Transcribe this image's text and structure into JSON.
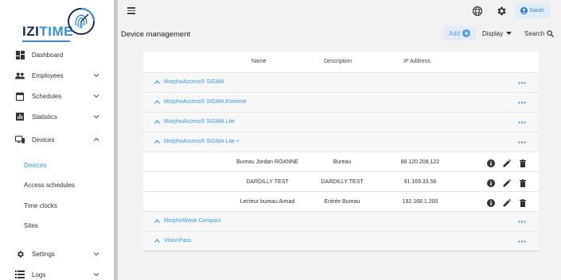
{
  "app": {
    "logo_part1": "IZI",
    "logo_part2": "TIME"
  },
  "sidebar": {
    "items": [
      {
        "label": "Dashboard"
      },
      {
        "label": "Employees"
      },
      {
        "label": "Schedules"
      },
      {
        "label": "Statistics"
      },
      {
        "label": "Devices"
      },
      {
        "label": "Settings"
      },
      {
        "label": "Logs"
      }
    ],
    "sub_items": [
      {
        "label": "Devices",
        "active": true
      },
      {
        "label": "Access schedules"
      },
      {
        "label": "Time clocks"
      },
      {
        "label": "Sites"
      }
    ]
  },
  "topbar": {
    "user_name": "Sarah"
  },
  "page": {
    "title": "Device management",
    "add_label": "Add",
    "display_label": "Display",
    "search_label": "Search"
  },
  "table": {
    "columns": [
      "Name",
      "Description",
      "IP Address"
    ],
    "groups": [
      {
        "label": "MorphoAccess® SIGMA"
      },
      {
        "label": "MorphoAccess® SIGMA Extreme"
      },
      {
        "label": "MorphoAccess® SIGMA Lite"
      },
      {
        "label": "MorphoAccess® SIGMA Lite +"
      },
      {
        "label": "MorphoWave Compact"
      },
      {
        "label": "VisionPass"
      }
    ],
    "rows": [
      {
        "name": "Bureau Jordan ROANNE",
        "description": "Bureau",
        "ip": "88.120.208.122"
      },
      {
        "name": "DARDILLY TEST",
        "description": "DARDILLY TEST",
        "ip": "91.169.33.56"
      },
      {
        "name": "Lecteur bureau Aimad",
        "description": "Entrée Bureau",
        "ip": "192.168.1.200"
      }
    ]
  },
  "colors": {
    "accent": "#3b9ad9",
    "logo_dark": "#1a2b4a"
  }
}
